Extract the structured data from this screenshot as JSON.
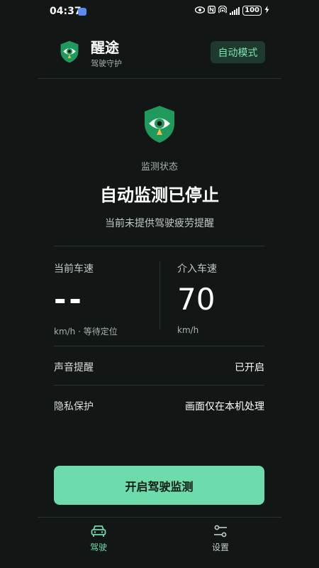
{
  "status_bar": {
    "time": "04:37",
    "battery": "100",
    "icons": [
      "eye-icon",
      "nfc-icon",
      "hotspot-icon",
      "signal-icon",
      "battery-icon",
      "charging-icon"
    ]
  },
  "header": {
    "app_name": "醒途",
    "app_subtitle": "驾驶守护",
    "mode_button": "自动模式"
  },
  "monitor": {
    "status_label": "监测状态",
    "status_title": "自动监测已停止",
    "status_desc": "当前未提供驾驶疲劳提醒"
  },
  "speed": {
    "current_label": "当前车速",
    "current_value": "--",
    "current_unit": "km/h · 等待定位",
    "intervene_label": "介入车速",
    "intervene_value": "70",
    "intervene_unit": "km/h"
  },
  "settings": {
    "sound_label": "声音提醒",
    "sound_value": "已开启",
    "privacy_label": "隐私保护",
    "privacy_value": "画面仅在本机处理"
  },
  "primary_button": "开启驾驶监测",
  "nav": {
    "drive_label": "驾驶",
    "settings_label": "设置"
  },
  "colors": {
    "background": "#121614",
    "accent": "#6edcaa",
    "shield_green": "#1f9a5c",
    "mode_button_bg": "#1e3a2e"
  }
}
